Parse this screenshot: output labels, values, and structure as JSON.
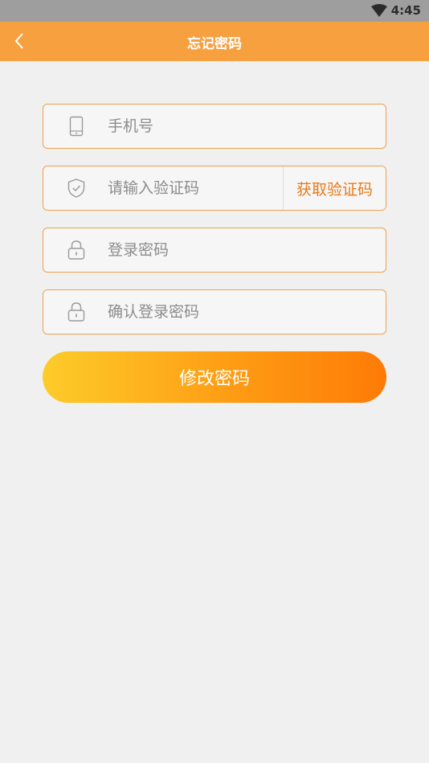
{
  "status_bar": {
    "time": "4:45"
  },
  "app_bar": {
    "title": "忘记密码"
  },
  "form": {
    "phone_placeholder": "手机号",
    "code_placeholder": "请输入验证码",
    "get_code_label": "获取验证码",
    "password_placeholder": "登录密码",
    "confirm_password_placeholder": "确认登录密码",
    "submit_label": "修改密码"
  },
  "colors": {
    "app_bar": "#f7a03f",
    "field_border": "#f0a04a",
    "accent_text": "#e97a18",
    "button_start": "#fdcc29",
    "button_end": "#fe7b06"
  }
}
